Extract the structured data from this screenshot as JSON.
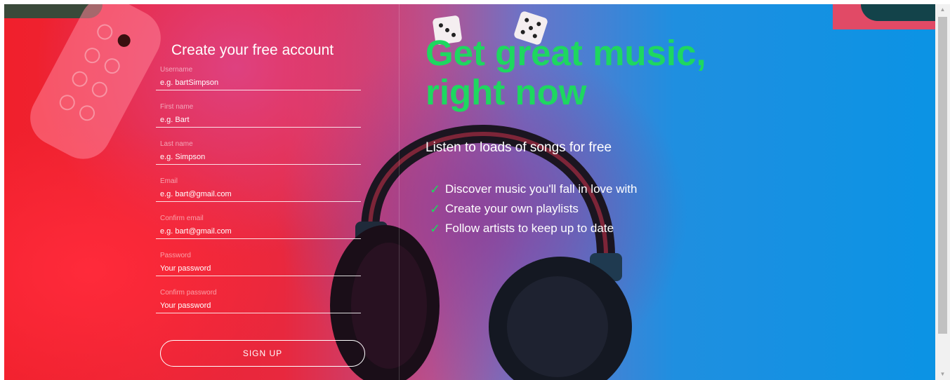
{
  "form": {
    "title": "Create your free account",
    "fields": [
      {
        "label": "Username",
        "placeholder": "e.g. bartSimpson"
      },
      {
        "label": "First name",
        "placeholder": "e.g. Bart"
      },
      {
        "label": "Last name",
        "placeholder": "e.g. Simpson"
      },
      {
        "label": "Email",
        "placeholder": "e.g. bart@gmail.com"
      },
      {
        "label": "Confirm email",
        "placeholder": "e.g. bart@gmail.com"
      },
      {
        "label": "Password",
        "placeholder": "Your password"
      },
      {
        "label": "Confirm password",
        "placeholder": "Your password"
      }
    ],
    "submit_label": "SIGN UP"
  },
  "promo": {
    "heading_line1": "Get great music,",
    "heading_line2": "right now",
    "subheading": "Listen to loads of songs for free",
    "features": [
      "Discover music you'll fall in love with",
      "Create your own playlists",
      "Follow artists to keep up to date"
    ],
    "check_glyph": "✓"
  },
  "scrollbar": {
    "up_glyph": "▲",
    "down_glyph": "▼"
  },
  "colors": {
    "accent_green": "#1ed760",
    "text": "#ffffff"
  }
}
